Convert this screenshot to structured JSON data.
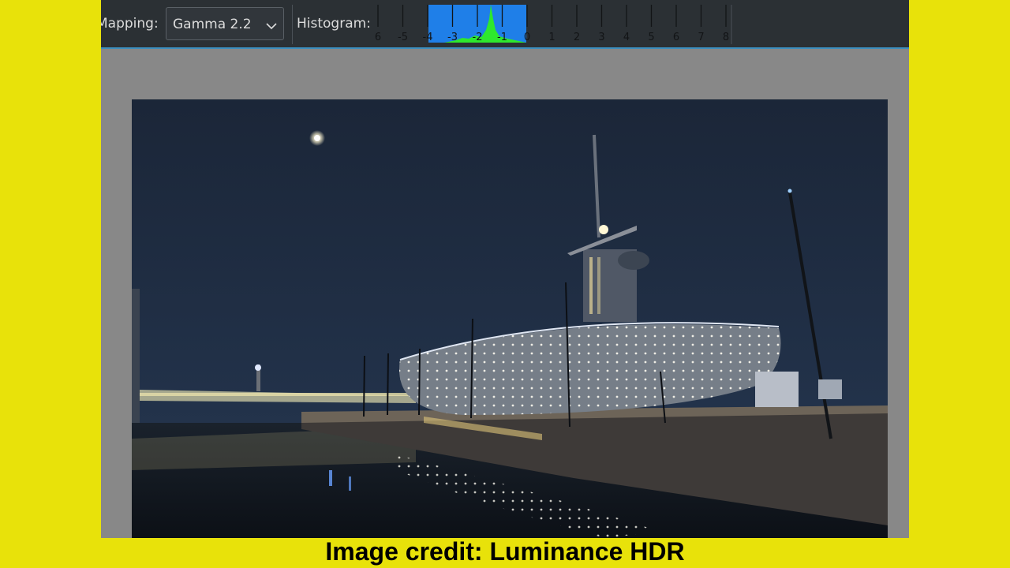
{
  "toolbar": {
    "mapping_label": "Mapping:",
    "mapping_value": "Gamma 2.2",
    "histogram_label": "Histogram:"
  },
  "histogram": {
    "ticks": [
      "6",
      "-5",
      "-4",
      "-3",
      "-2",
      "-1",
      "0",
      "1",
      "2",
      "3",
      "4",
      "5",
      "6",
      "7",
      "8"
    ],
    "range_bar_color": "#1f7fe8",
    "curve_color": "#2ee82e"
  },
  "credit": "Image credit: Luminance HDR",
  "colors": {
    "page_background": "#e8e20a",
    "toolbar": "#2b3034",
    "viewer_background": "#888888",
    "sky": "#1f2c40"
  }
}
